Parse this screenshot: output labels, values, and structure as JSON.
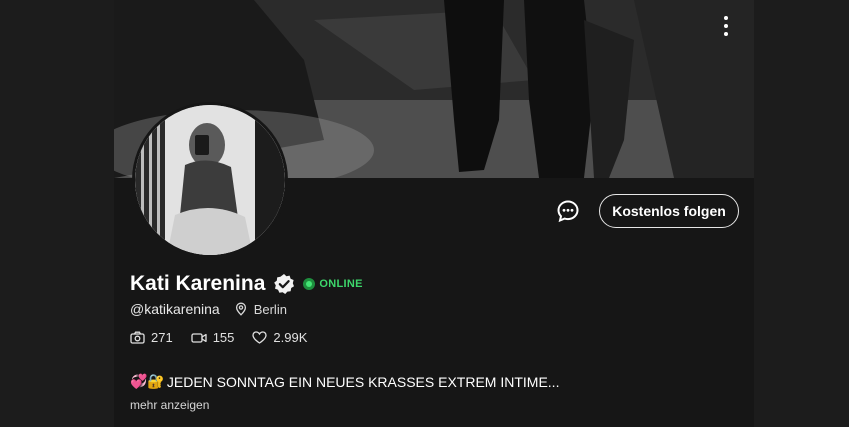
{
  "profile": {
    "name": "Kati Karenina",
    "status": "ONLINE",
    "handle": "@katikarenina",
    "location": "Berlin",
    "follow_label": "Kostenlos folgen",
    "stats": {
      "photos": "271",
      "videos": "155",
      "likes": "2.99K"
    },
    "bio_emoji": "💞🔐",
    "bio": "JEDEN SONNTAG EIN NEUES KRASSES EXTREM INTIME...",
    "more_label": "mehr anzeigen"
  },
  "icons": {
    "menu": "kebab-menu-icon",
    "chat": "chat-bubble-icon",
    "verified": "verified-check-icon",
    "location": "map-pin-icon",
    "photos": "camera-icon",
    "videos": "video-camera-icon",
    "likes": "heart-icon"
  },
  "colors": {
    "background": "#1c1c1c",
    "panel": "#161616",
    "online": "#3dd66b",
    "text": "#ffffff"
  }
}
